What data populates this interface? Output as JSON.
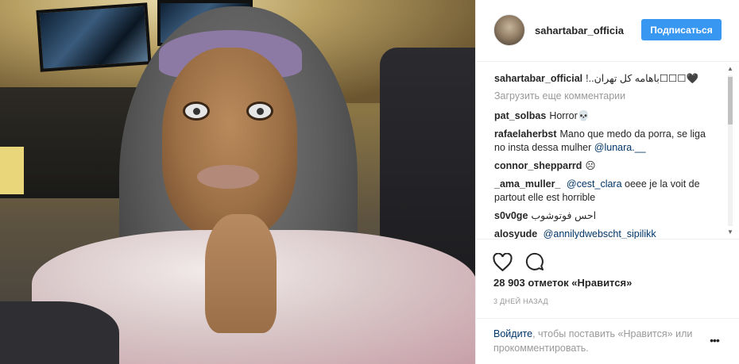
{
  "post": {
    "header": {
      "username": "sahartabar_officia",
      "follow_label": "Подписаться"
    },
    "caption": {
      "username": "sahartabar_official",
      "text": "!..باهامه کل تهران☐☐☐🖤"
    },
    "load_more_label": "Загрузить еще комментарии",
    "comments": [
      {
        "user": "pat_solbas",
        "text": "Horror💀",
        "mention": ""
      },
      {
        "user": "rafaelaherbst",
        "text": "Mano que medo da porra, se liga no insta dessa mulher",
        "mention": "@lunara.__"
      },
      {
        "user": "connor_shepparrd",
        "text": "☹",
        "mention": ""
      },
      {
        "user": "_ama_muller_",
        "text_pre_mention": "",
        "mention": "@cest_clara",
        "text": "oeee je la voit de partout elle est horrible"
      },
      {
        "user": "s0v0ge",
        "text": "احس فوتوشوب",
        "mention": ""
      },
      {
        "user": "alosyude",
        "text": "",
        "mention": "@annilydwebscht_sipilikk"
      }
    ],
    "likes_text": "28 903 отметок «Нравится»",
    "time_text": "3 ДНЕЙ НАЗАД",
    "footer": {
      "login_link": "Войдите",
      "rest": ", чтобы поставить «Нравится» или прокомментировать.",
      "more_icon": "more-dots-icon"
    },
    "icons": {
      "like": "heart-icon",
      "comment": "comment-bubble-icon"
    },
    "colors": {
      "follow_button": "#3897f0",
      "link": "#003569",
      "muted": "#999999"
    }
  }
}
